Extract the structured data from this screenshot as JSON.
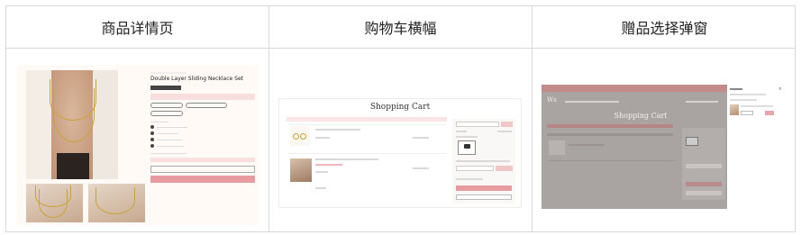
{
  "columns": [
    {
      "title": "商品详情页"
    },
    {
      "title": "购物车横幅"
    },
    {
      "title": "赠品选择弹窗"
    }
  ],
  "product_page": {
    "title": "Double Layer Sliding Necklace Set",
    "add_to_cart_label": "ADD TO CART",
    "buy_now_label": "BUY IT NOW",
    "accent_color": "#e79aa0"
  },
  "cart_page": {
    "title": "Shopping Cart",
    "accent_color": "#e79aa0"
  },
  "gift_modal": {
    "cart_title": "Shopping Cart",
    "logo": "Ws",
    "top_bar_color": "#c48b8b"
  }
}
